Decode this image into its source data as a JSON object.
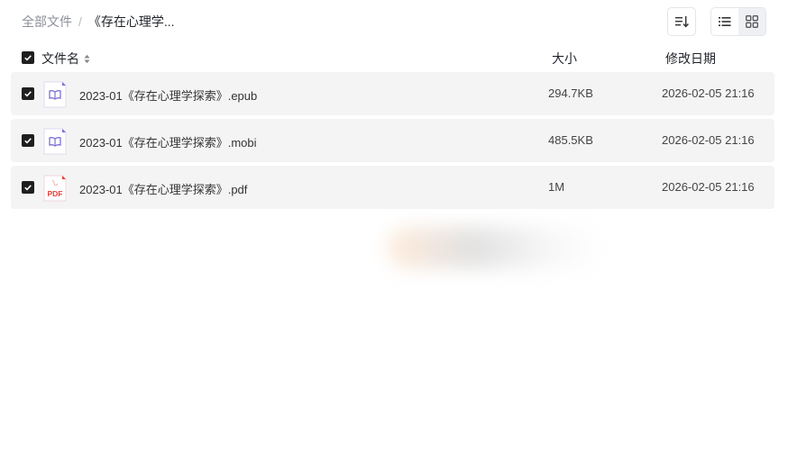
{
  "breadcrumb": {
    "root": "全部文件",
    "separator": "/",
    "current": "《存在心理学..."
  },
  "toolbar": {
    "sort_icon": "sort-icon",
    "list_view_icon": "list-view-icon",
    "grid_view_icon": "grid-view-icon"
  },
  "header": {
    "name": "文件名",
    "size": "大小",
    "date": "修改日期"
  },
  "files": [
    {
      "name": "2023-01《存在心理学探索》.epub",
      "size": "294.7KB",
      "date": "2026-02-05 21:16",
      "type": "ebook"
    },
    {
      "name": "2023-01《存在心理学探索》.mobi",
      "size": "485.5KB",
      "date": "2026-02-05 21:16",
      "type": "ebook"
    },
    {
      "name": "2023-01《存在心理学探索》.pdf",
      "size": "1M",
      "date": "2026-02-05 21:16",
      "type": "pdf"
    }
  ],
  "icons": {
    "pdf_label": "PDF"
  },
  "colors": {
    "checkbox": "#1f1f1f",
    "row_bg": "#f4f4f5",
    "ebook_icon": "#7b6fd6",
    "pdf_icon": "#e8413c"
  }
}
